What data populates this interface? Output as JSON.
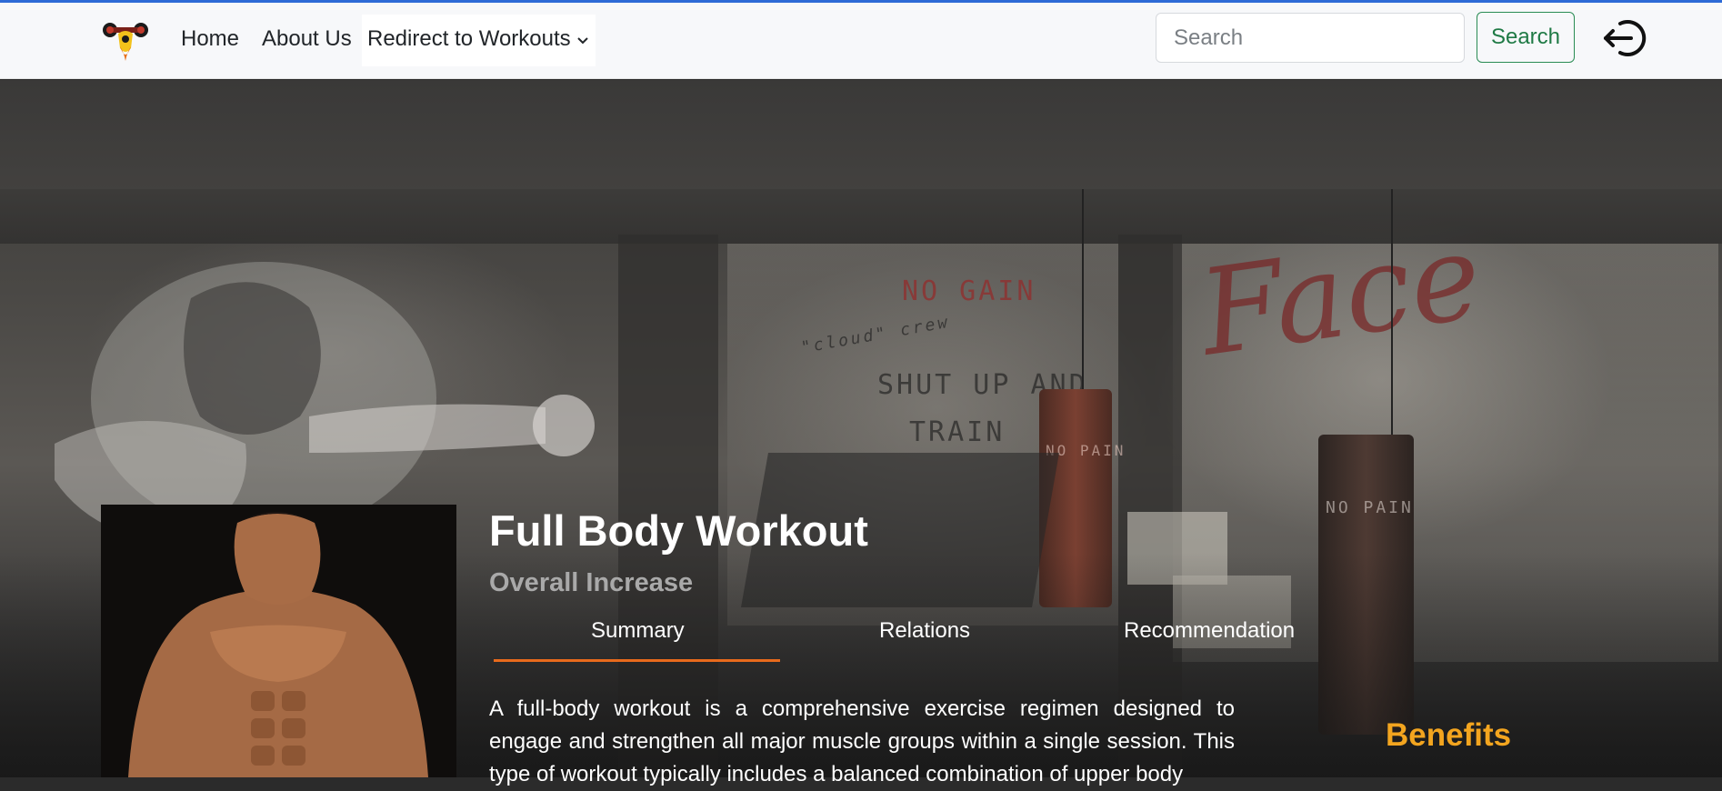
{
  "navbar": {
    "links": [
      "Home",
      "About Us"
    ],
    "dropdown_label": "Redirect to Workouts",
    "search_placeholder": "Search",
    "search_button": "Search"
  },
  "workout": {
    "title": "Full Body Workout",
    "subtitle": "Overall Increase",
    "tabs": [
      "Summary",
      "Relations",
      "Recommendation"
    ],
    "active_tab": "Summary",
    "description": "A full-body workout is a comprehensive exercise regimen designed to engage and strengthen all major muscle groups within a single session. This type of workout typically includes a balanced combination of upper body",
    "benefits_heading": "Benefits"
  },
  "background_wall_text": {
    "no_gain": "NO GAIN",
    "shut_up": "SHUT UP AND",
    "train": "TRAIN",
    "crew": "\"cloud\" crew",
    "face": "Face",
    "bag_label": "NO PAIN"
  },
  "colors": {
    "accent_orange": "#e86a1c",
    "benefits_gold": "#f3a51f",
    "search_green": "#1f7a45",
    "top_line_blue": "#2d6ad6"
  },
  "icons": {
    "logo": "strongman-logo-icon",
    "dropdown": "chevron-down-icon",
    "logout": "logout-icon"
  }
}
